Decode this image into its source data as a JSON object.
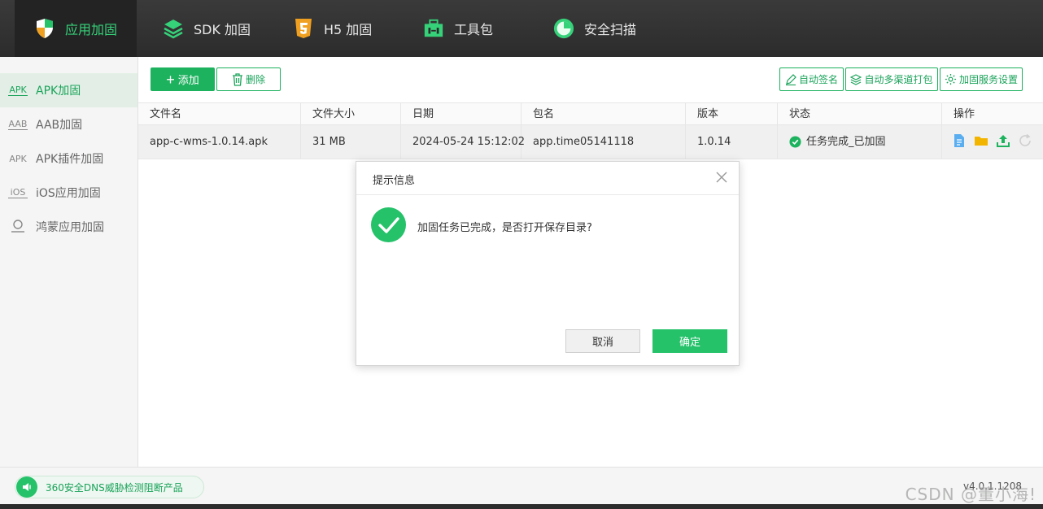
{
  "nav": {
    "tabs": [
      {
        "label": "应用加固",
        "icon": "shield-icon"
      },
      {
        "label": "SDK 加固",
        "icon": "layers-icon"
      },
      {
        "label": "H5 加固",
        "icon": "html5-icon"
      },
      {
        "label": "工具包",
        "icon": "toolbox-icon"
      },
      {
        "label": "安全扫描",
        "icon": "scan-icon"
      }
    ]
  },
  "sidebar": {
    "items": [
      {
        "badge": "APK",
        "label": "APK加固"
      },
      {
        "badge": "AAB",
        "label": "AAB加固"
      },
      {
        "badge": "APK",
        "label": "APK插件加固"
      },
      {
        "badge": "iOS",
        "label": "iOS应用加固"
      },
      {
        "badge": "",
        "label": "鸿蒙应用加固"
      }
    ]
  },
  "toolbar": {
    "add_label": "添加",
    "delete_label": "删除",
    "auto_sign_label": "自动签名",
    "auto_multichannel_label": "自动多渠道打包",
    "service_settings_label": "加固服务设置"
  },
  "table": {
    "headers": [
      "文件名",
      "文件大小",
      "日期",
      "包名",
      "版本",
      "状态",
      "操作"
    ],
    "rows": [
      {
        "filename": "app-c-wms-1.0.14.apk",
        "size": "31 MB",
        "date": "2024-05-24 15:12:02",
        "package": "app.time05141118",
        "version": "1.0.14",
        "status": "任务完成_已加固"
      }
    ]
  },
  "dialog": {
    "title": "提示信息",
    "message": "加固任务已完成，是否打开保存目录?",
    "cancel_label": "取消",
    "ok_label": "确定"
  },
  "footer": {
    "dns_text": "360安全DNS威胁检测阻断产品",
    "version": "v4.0.1.1208",
    "watermark": "CSDN @董小海!"
  },
  "colors": {
    "accent": "#1db25e",
    "topbar": "#2c2c2c"
  }
}
